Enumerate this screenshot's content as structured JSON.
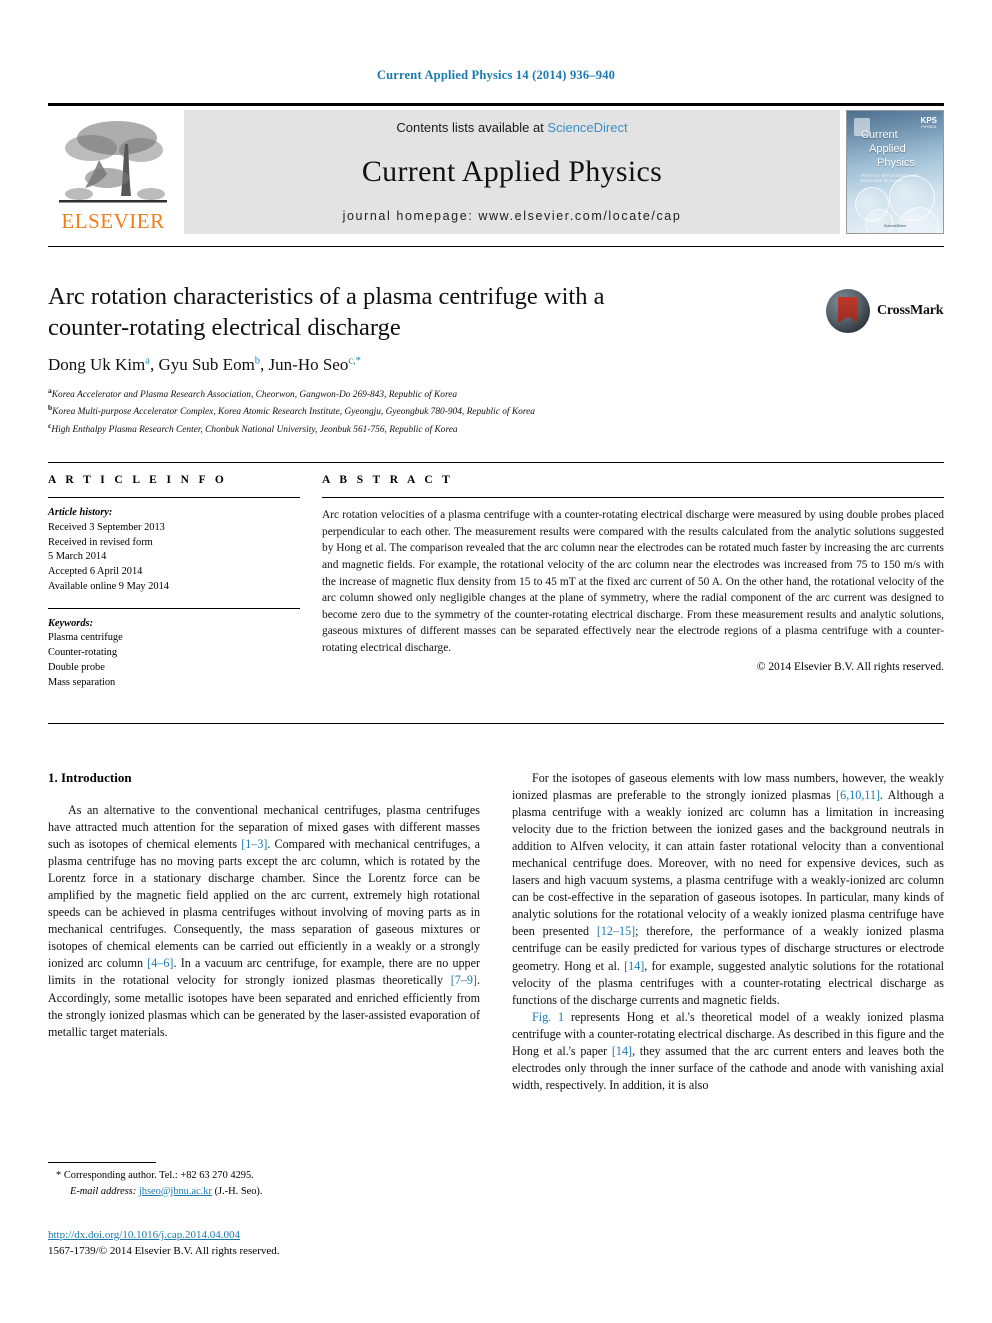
{
  "running_head": "Current Applied Physics 14 (2014) 936–940",
  "masthead": {
    "publisher_name": "ELSEVIER",
    "contents_prefix": "Contents lists available at ",
    "contents_link": "ScienceDirect",
    "journal_title": "Current Applied Physics",
    "homepage": "journal homepage: www.elsevier.com/locate/cap",
    "cover": {
      "title_line1": "Current",
      "title_line2": "Applied",
      "title_line3": "Physics",
      "subtitle": "Physics, Electronics and Materials Science",
      "society": "KPS",
      "society_sub": "PHYSICS",
      "footer": "ScienceDirect"
    }
  },
  "article": {
    "title_line1": "Arc rotation characteristics of a plasma centrifuge with a",
    "title_line2": "counter-rotating electrical discharge",
    "authors": [
      {
        "name": "Dong Uk Kim",
        "sup": "a"
      },
      {
        "name": "Gyu Sub Eom",
        "sup": "b"
      },
      {
        "name": "Jun-Ho Seo",
        "sup": "c,*"
      }
    ],
    "affiliations": [
      {
        "mark": "a",
        "text": "Korea Accelerator and Plasma Research Association, Cheorwon, Gangwon-Do 269-843, Republic of Korea"
      },
      {
        "mark": "b",
        "text": "Korea Multi-purpose Accelerator Complex, Korea Atomic Research Institute, Gyeongju, Gyeongbuk 780-904, Republic of Korea"
      },
      {
        "mark": "c",
        "text": "High Enthalpy Plasma Research Center, Chonbuk National University, Jeonbuk 561-756, Republic of Korea"
      }
    ],
    "crossmark_label": "CrossMark"
  },
  "article_info": {
    "heading": "A R T I C L E  I N F O",
    "history_label": "Article history:",
    "history": [
      "Received 3 September 2013",
      "Received in revised form",
      "5 March 2014",
      "Accepted 6 April 2014",
      "Available online 9 May 2014"
    ],
    "keywords_label": "Keywords:",
    "keywords": [
      "Plasma centrifuge",
      "Counter-rotating",
      "Double probe",
      "Mass separation"
    ]
  },
  "abstract": {
    "heading": "A B S T R A C T",
    "text": "Arc rotation velocities of a plasma centrifuge with a counter-rotating electrical discharge were measured by using double probes placed perpendicular to each other. The measurement results were compared with the results calculated from the analytic solutions suggested by Hong et al. The comparison revealed that the arc column near the electrodes can be rotated much faster by increasing the arc currents and magnetic fields. For example, the rotational velocity of the arc column near the electrodes was increased from 75 to 150 m/s with the increase of magnetic flux density from 15 to 45 mT at the fixed arc current of 50 A. On the other hand, the rotational velocity of the arc column showed only negligible changes at the plane of symmetry, where the radial component of the arc current was designed to become zero due to the symmetry of the counter-rotating electrical discharge. From these measurement results and analytic solutions, gaseous mixtures of different masses can be separated effectively near the electrode regions of a plasma centrifuge with a counter-rotating electrical discharge.",
    "copyright": "© 2014 Elsevier B.V. All rights reserved."
  },
  "body": {
    "section_heading": "1. Introduction",
    "left_para_1_a": "As an alternative to the conventional mechanical centrifuges, plasma centrifuges have attracted much attention for the separation of mixed gases with different masses such as isotopes of chemical elements ",
    "left_ref_1": "[1–3]",
    "left_para_1_b": ". Compared with mechanical centrifuges, a plasma centrifuge has no moving parts except the arc column, which is rotated by the Lorentz force in a stationary discharge chamber. Since the Lorentz force can be amplified by the magnetic field applied on the arc current, extremely high rotational speeds can be achieved in plasma centrifuges without involving of moving parts as in mechanical centrifuges. Consequently, the mass separation of gaseous mixtures or isotopes of chemical elements can be carried out efficiently in a weakly or a strongly ionized arc column ",
    "left_ref_2": "[4–6]",
    "left_para_1_c": ". In a vacuum arc centrifuge, for example, there are no upper limits in the rotational velocity for strongly ionized plasmas theoretically ",
    "left_ref_3": "[7–9]",
    "left_para_1_d": ". Accordingly, some metallic isotopes have been separated and enriched efficiently from the strongly ionized plasmas which can be generated by the laser-assisted evaporation of metallic target materials.",
    "right_para_1_a": "For the isotopes of gaseous elements with low mass numbers, however, the weakly ionized plasmas are preferable to the strongly ionized plasmas ",
    "right_ref_1": "[6,10,11]",
    "right_para_1_b": ". Although a plasma centrifuge with a weakly ionized arc column has a limitation in increasing velocity due to the friction between the ionized gases and the background neutrals in addition to Alfven velocity, it can attain faster rotational velocity than a conventional mechanical centrifuge does. Moreover, with no need for expensive devices, such as lasers and high vacuum systems, a plasma centrifuge with a weakly-ionized arc column can be cost-effective in the separation of gaseous isotopes. In particular, many kinds of analytic solutions for the rotational velocity of a weakly ionized plasma centrifuge have been presented ",
    "right_ref_2": "[12–15]",
    "right_para_1_c": "; therefore, the performance of a weakly ionized plasma centrifuge can be easily predicted for various types of discharge structures or electrode geometry. Hong et al. ",
    "right_ref_3": "[14]",
    "right_para_1_d": ", for example, suggested analytic solutions for the rotational velocity of the plasma centrifuges with a counter-rotating electrical discharge as functions of the discharge currents and magnetic fields.",
    "right_fig_ref": "Fig. 1",
    "right_para_2_a": " represents Hong et al.'s theoretical model of a weakly ionized plasma centrifuge with a counter-rotating electrical discharge. As described in this figure and the Hong et al.'s paper ",
    "right_ref_4": "[14]",
    "right_para_2_b": ", they assumed that the arc current enters and leaves both the electrodes only through the inner surface of the cathode and anode with vanishing axial width, respectively. In addition, it is also"
  },
  "footer": {
    "corresponding_mark": "*",
    "corresponding_text": "Corresponding author. Tel.: +82 63 270 4295.",
    "email_label": "E-mail address:",
    "email": "jhseo@jbnu.ac.kr",
    "email_suffix": "(J.-H. Seo).",
    "doi": "http://dx.doi.org/10.1016/j.cap.2014.04.004",
    "issn_line": "1567-1739/© 2014 Elsevier B.V. All rights reserved."
  },
  "colors": {
    "link": "#1a7ab0",
    "sciencedirect": "#3a8fc4",
    "elsevier_orange": "#ef7d1a",
    "band_gray": "#e3e3e3"
  }
}
